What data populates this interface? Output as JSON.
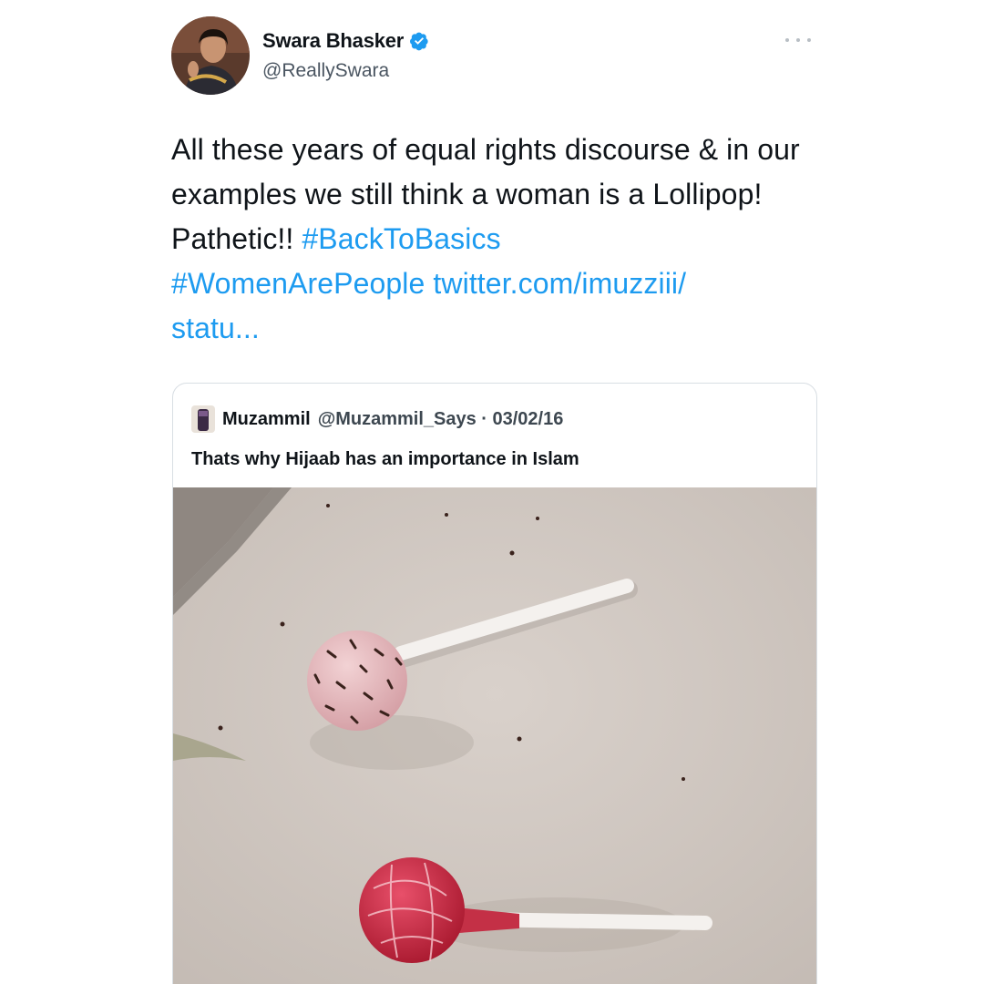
{
  "tweet": {
    "author": {
      "display_name": "Swara Bhasker",
      "handle": "@ReallySwara",
      "verified": true
    },
    "text_plain": "All these years of equal rights discourse & in our examples we still think a woman is a Lollipop! Pathetic!! ",
    "hashtag_1": "#BackToBasics",
    "hashtag_2": "#WomenArePeople",
    "link": "twitter.com/imuzziii/",
    "link_cont": "statu..."
  },
  "quoted_tweet": {
    "display_name": "Muzammil",
    "meta": "@Muzammil_Says · 03/02/16",
    "text": "Thats why Hijaab has an importance in Islam"
  },
  "colors": {
    "link": "#1d9bf0",
    "verified": "#1d9bf0",
    "border": "#d8dee3"
  },
  "icons": {
    "verified": "verified-badge-icon",
    "more": "more-options-icon"
  }
}
